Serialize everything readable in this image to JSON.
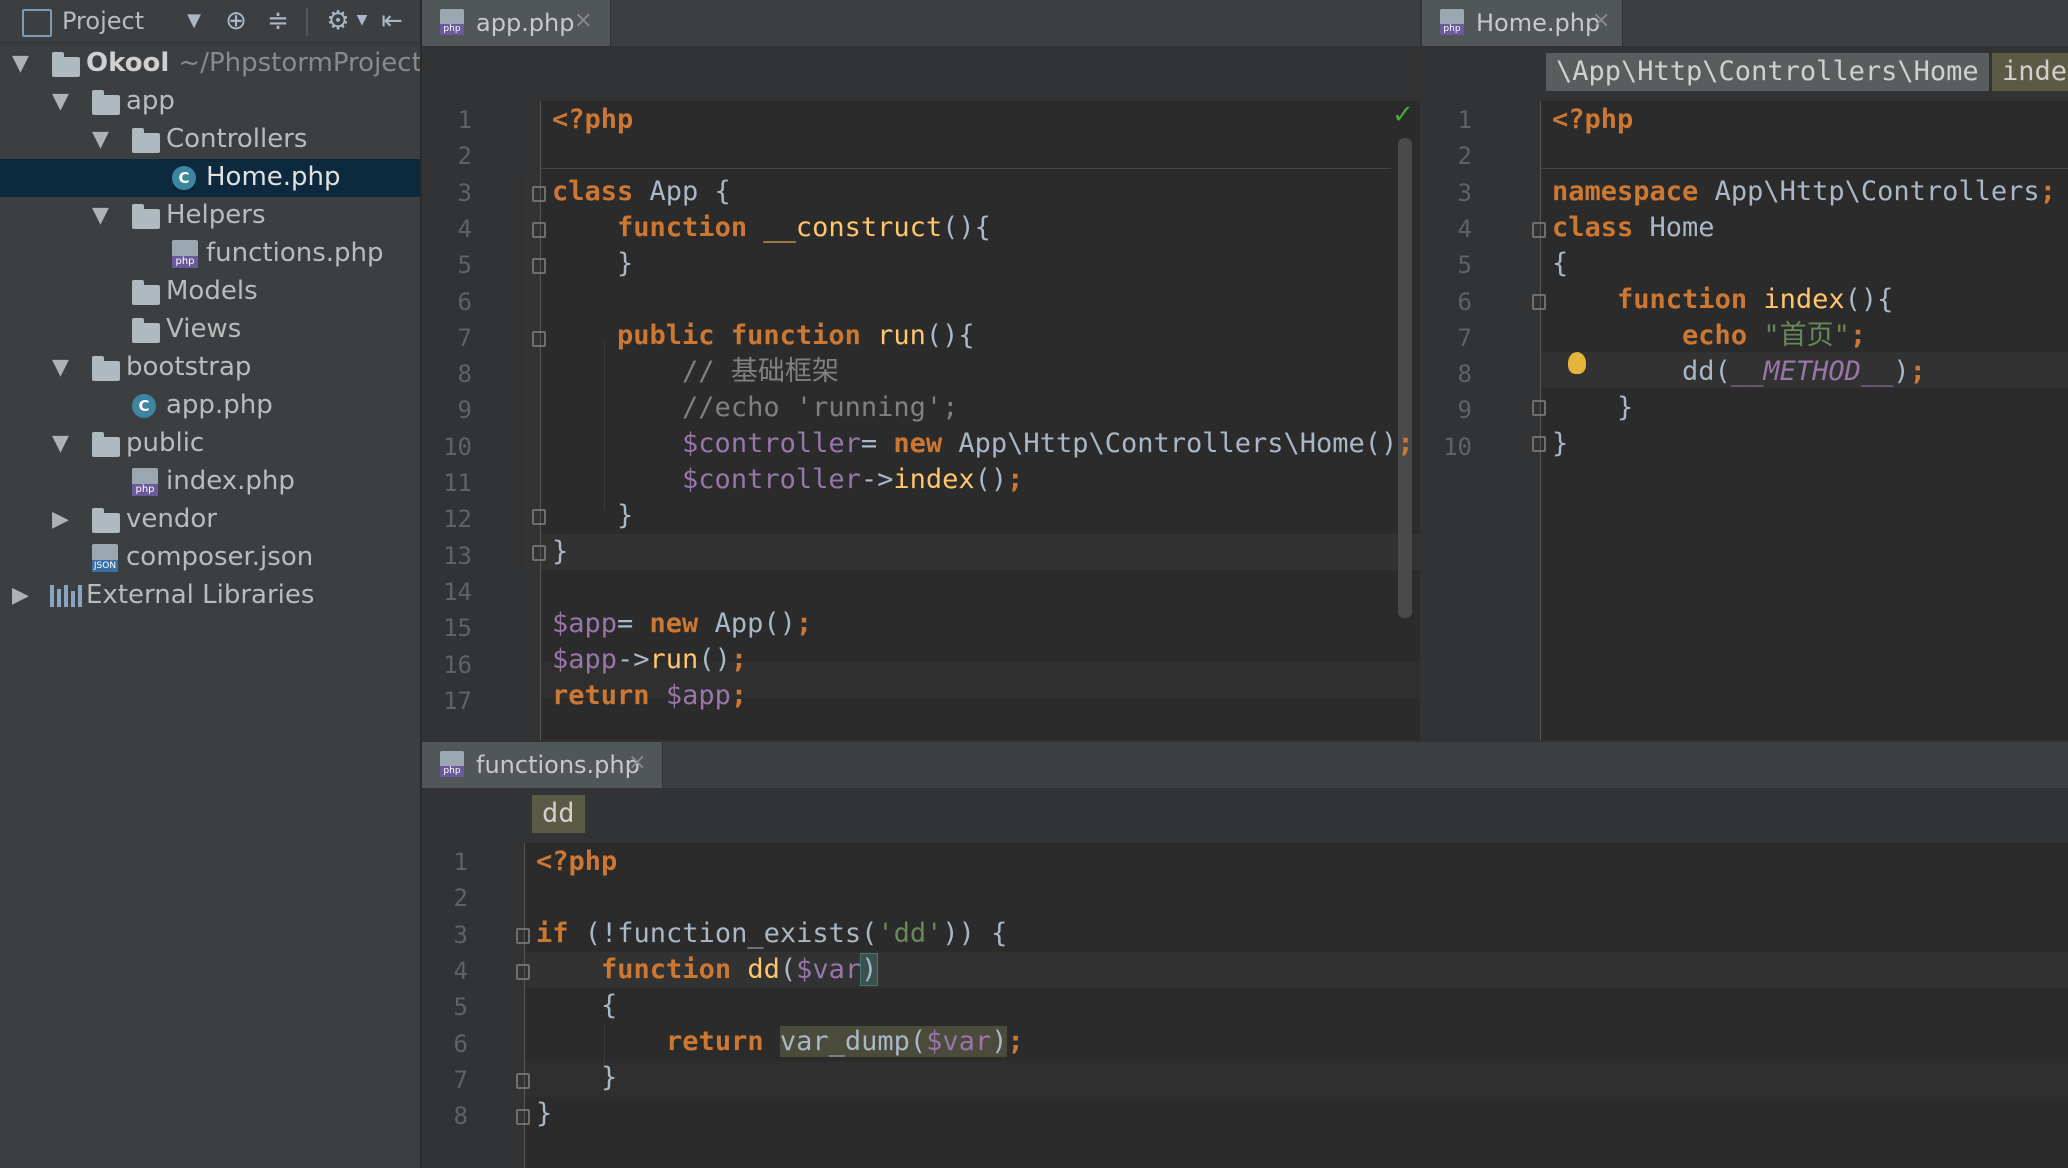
{
  "sidebar": {
    "toolbar_label": "Project",
    "tree": [
      {
        "label": "Okool",
        "path": "~/PhpstormProjects"
      },
      {
        "label": "app"
      },
      {
        "label": "Controllers"
      },
      {
        "label": "Home.php"
      },
      {
        "label": "Helpers"
      },
      {
        "label": "functions.php"
      },
      {
        "label": "Models"
      },
      {
        "label": "Views"
      },
      {
        "label": "bootstrap"
      },
      {
        "label": "app.php"
      },
      {
        "label": "public"
      },
      {
        "label": "index.php"
      },
      {
        "label": "vendor"
      },
      {
        "label": "composer.json"
      },
      {
        "label": "External Libraries"
      }
    ],
    "icons": {
      "c": "C",
      "php": "php",
      "json": "JSON"
    }
  },
  "editor_left": {
    "tab": "app.php",
    "close": "×",
    "check": "✓",
    "line_numbers": [
      "1",
      "2",
      "3",
      "4",
      "5",
      "6",
      "7",
      "8",
      "9",
      "10",
      "11",
      "12",
      "13",
      "14",
      "15",
      "16",
      "17"
    ]
  },
  "editor_right": {
    "tab": "Home.php",
    "close": "×",
    "breadcrumb": [
      "\\App\\Http\\Controllers\\Home",
      "index"
    ],
    "line_numbers": [
      "1",
      "2",
      "3",
      "4",
      "5",
      "6",
      "7",
      "8",
      "9",
      "10"
    ]
  },
  "editor_bottom": {
    "tab": "functions.php",
    "close": "×",
    "breadcrumb": [
      "dd"
    ],
    "line_numbers": [
      "1",
      "2",
      "3",
      "4",
      "5",
      "6",
      "7",
      "8"
    ]
  },
  "colors": {
    "keyword": "#cc7832",
    "function": "#ffc66d",
    "variable": "#9876aa",
    "string": "#6a8759",
    "comment": "#808080",
    "text": "#a9b7c6"
  }
}
